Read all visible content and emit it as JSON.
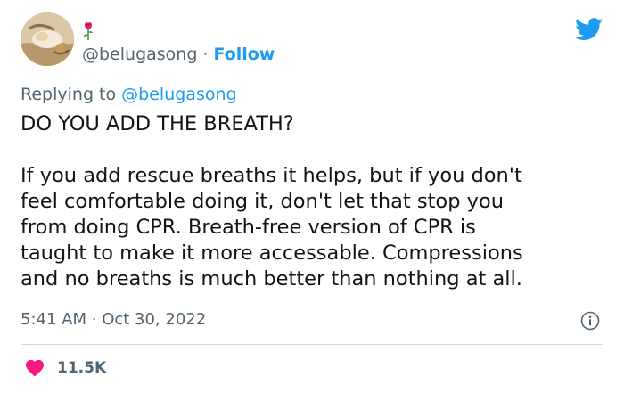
{
  "author": {
    "handle": "@belugasong",
    "separator": "·",
    "follow_label": "Follow",
    "avatar_icon": "painting-avatar",
    "badge_icon": "rose-icon"
  },
  "reply": {
    "prefix": "Replying to",
    "mention": "@belugasong"
  },
  "tweet": {
    "lines_1": [
      "DO YOU ADD THE BREATH?"
    ],
    "lines_2": [
      "If you add rescue breaths it helps, but if you don't",
      "feel comfortable doing it, don't let that stop you",
      "from doing CPR. Breath-free version of CPR is",
      "taught to make it more accessable. Compressions",
      "and no breaths is much better than nothing at all."
    ]
  },
  "meta": {
    "time": "5:41 AM",
    "separator": "·",
    "date": "Oct 30, 2022"
  },
  "engagement": {
    "likes": "11.5K"
  },
  "colors": {
    "accent": "#1d9bf0",
    "heart": "#f91880",
    "muted_text": "#536471",
    "text": "#0f1419",
    "divider": "#cfd9de"
  }
}
